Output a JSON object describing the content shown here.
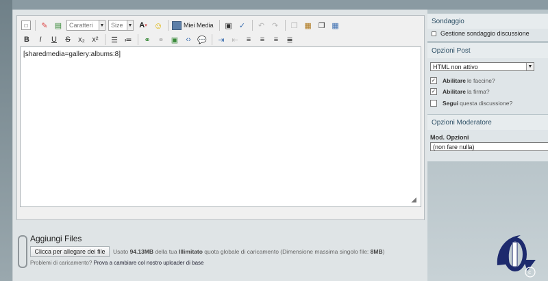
{
  "editor": {
    "font_dropdown": "Caratteri",
    "size_dropdown": "Size",
    "media_button": "Miei Media",
    "content": "[sharedmedia=gallery:albums:8]"
  },
  "attachments": {
    "title": "Aggiungi Files",
    "button": "Clicca per allegare dei file",
    "info_prefix": "Usato ",
    "used": "94.13MB",
    "info_mid": " della tua ",
    "limit": "Illimitato",
    "info_mid2": " quota globale di caricamento (Dimensione massima singolo file: ",
    "max": "8MB",
    "info_end": ")",
    "problems_text": "Problemi di caricamento? ",
    "problems_link": "Prova a cambiare col nostro uploader di base"
  },
  "sidebar": {
    "poll_title": "Sondaggio",
    "poll_item": "Gestione sondaggio discussione",
    "post_options_title": "Opzioni Post",
    "html_select": "HTML non attivo",
    "cb1_bold": "Abilitare",
    "cb1_rest": " le faccine?",
    "cb2_bold": "Abilitare",
    "cb2_rest": " la firma?",
    "cb3_bold": "Segui",
    "cb3_rest": " questa discussione?",
    "mod_title": "Opzioni Moderatore",
    "mod_label": "Mod. Opzioni",
    "mod_select": "(non fare nulla)"
  }
}
